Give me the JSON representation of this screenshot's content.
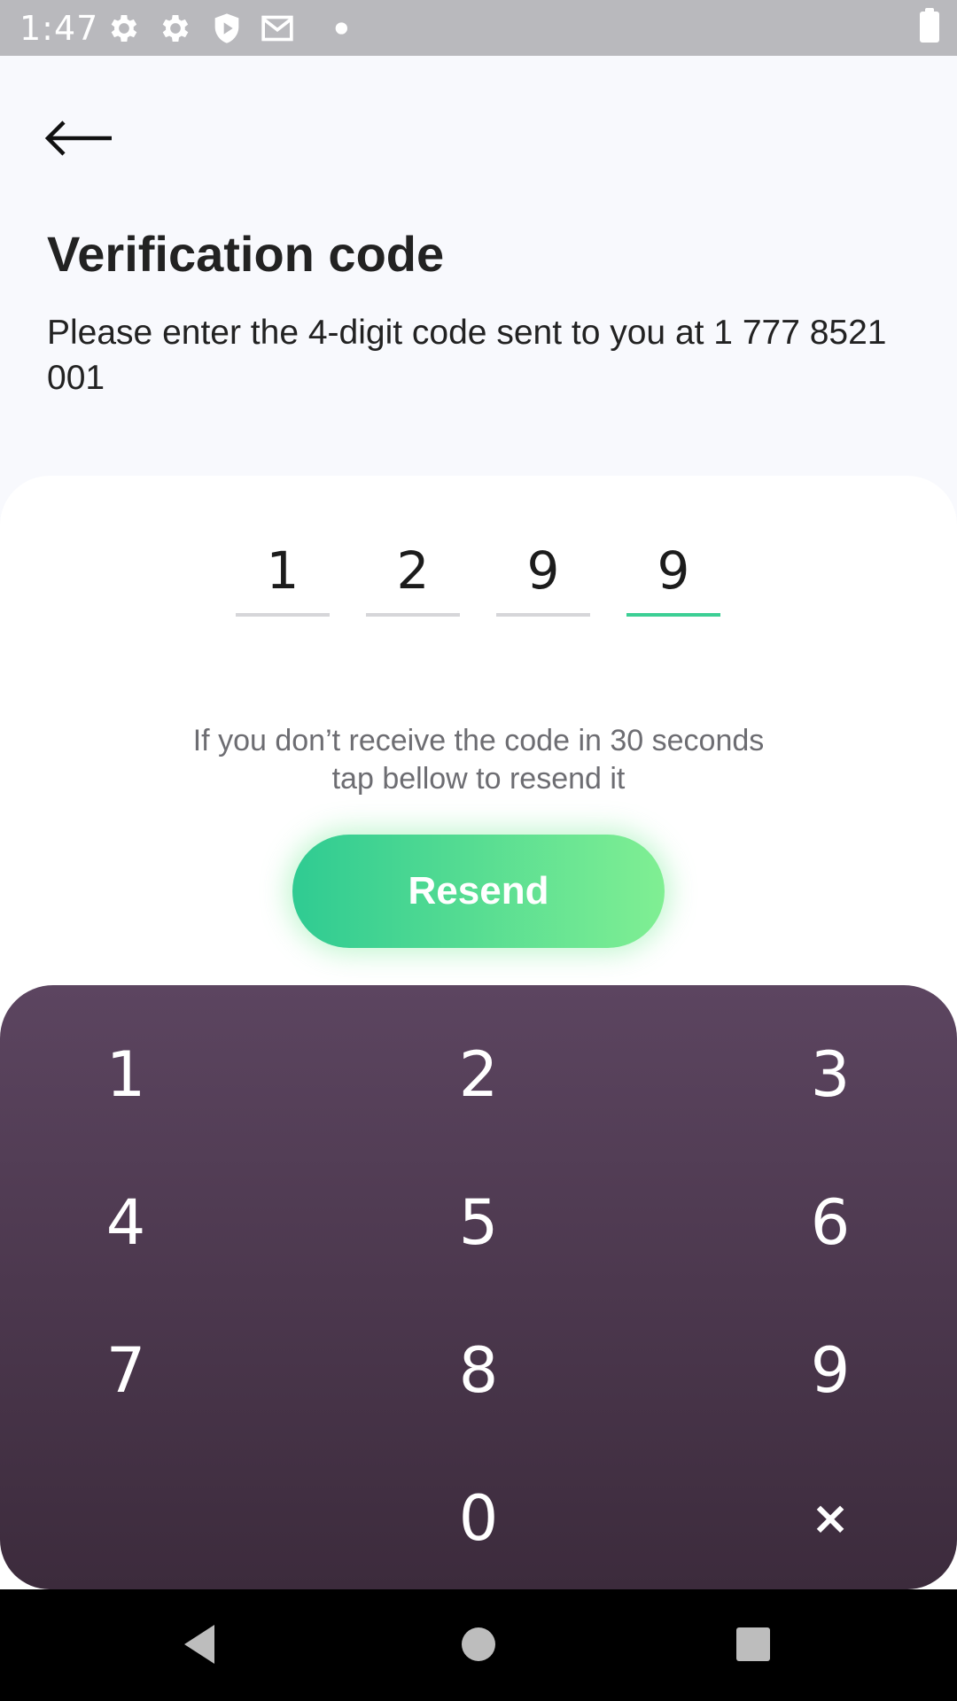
{
  "status_bar": {
    "time": "1:47",
    "icons": [
      "settings-icon",
      "settings-icon",
      "shield-play-icon",
      "mail-icon",
      "notification-dot-icon",
      "battery-icon"
    ]
  },
  "header": {
    "back_icon": "arrow-left-icon",
    "title": "Verification code",
    "subtitle": "Please enter the 4-digit code sent to you at 1 777 8521 001"
  },
  "code": {
    "digits": [
      "1",
      "2",
      "9",
      "9"
    ],
    "active_index": 3,
    "active_color": "#3ccf95"
  },
  "resend": {
    "hint_line1": "If you don’t receive the code in 30 seconds",
    "hint_line2": "tap bellow to resend it",
    "button_label": "Resend"
  },
  "keypad": {
    "keys": [
      "1",
      "2",
      "3",
      "4",
      "5",
      "6",
      "7",
      "8",
      "9",
      "0"
    ],
    "delete_label": "×"
  },
  "colors": {
    "accent_start": "#2fcb92",
    "accent_end": "#80ef93",
    "keypad_top": "#5c4560",
    "keypad_bottom": "#3c2b3c"
  },
  "nav_bar": {
    "icons": [
      "back-triangle-icon",
      "home-circle-icon",
      "recents-square-icon"
    ]
  }
}
